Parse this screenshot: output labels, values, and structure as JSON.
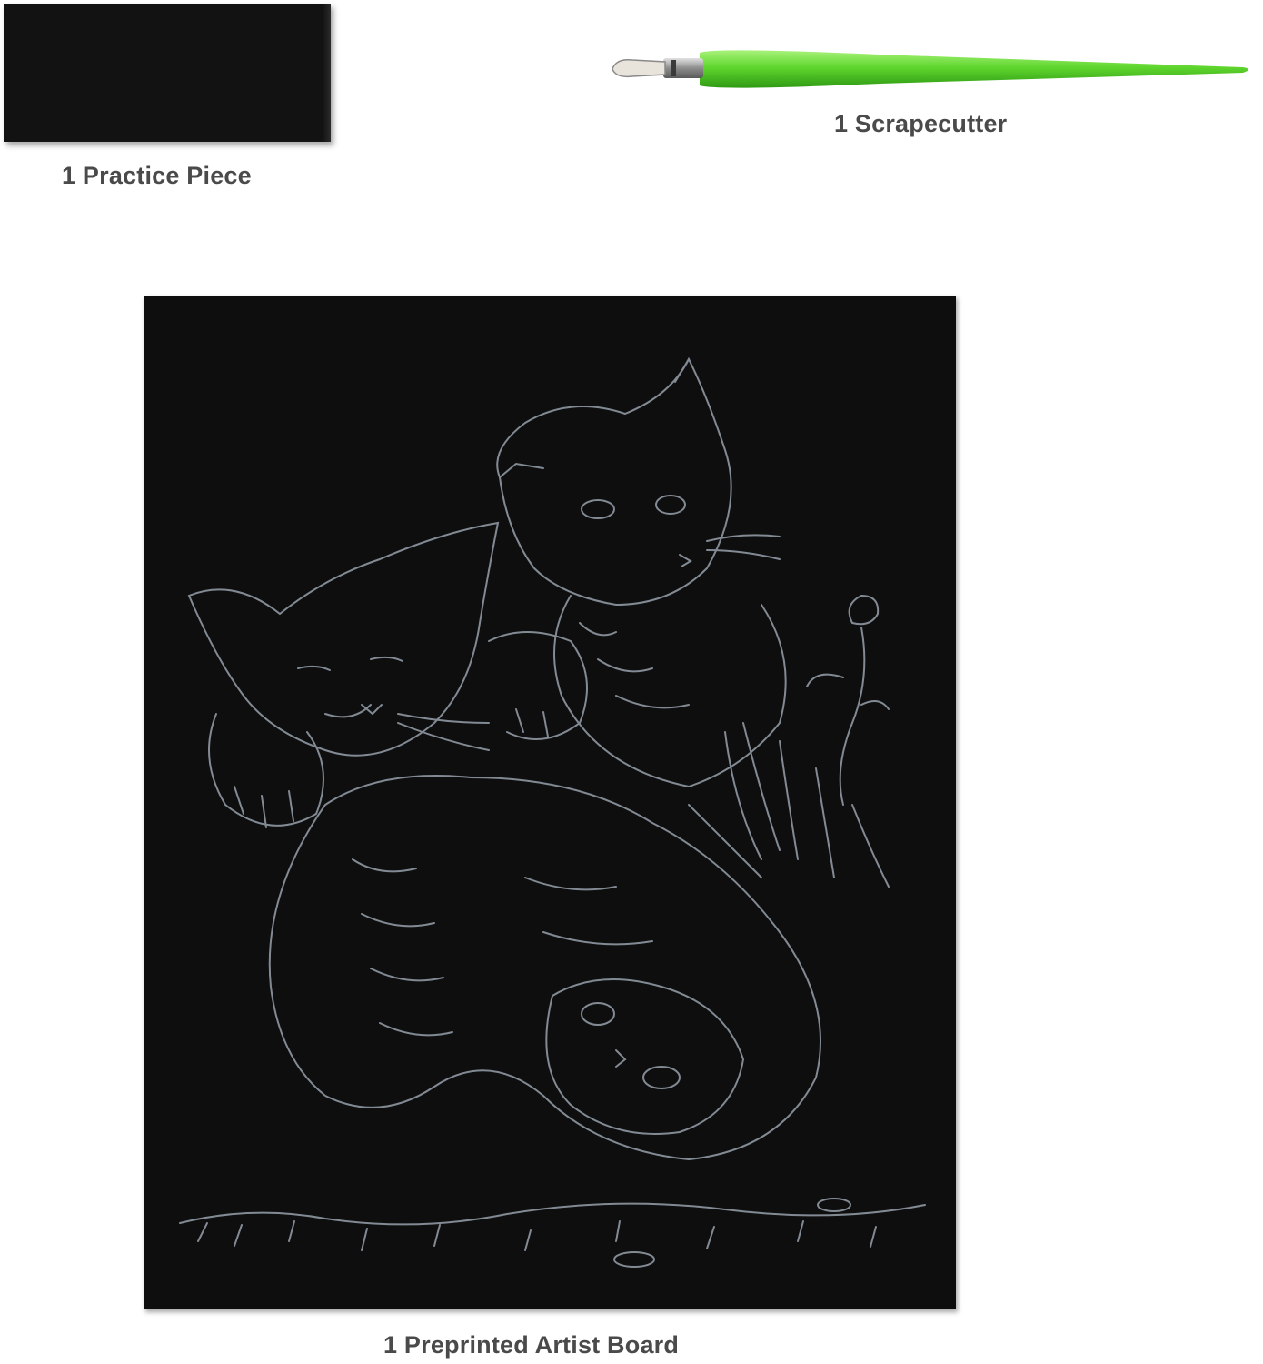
{
  "items": {
    "practice_piece": {
      "label": "1 Practice Piece",
      "color": "#121212"
    },
    "scrapecutter": {
      "label": "1 Scrapecutter",
      "handle_color": "#5fd62e",
      "tip_color": "#b8b8b8"
    },
    "artist_board": {
      "label": "1 Preprinted Artist Board",
      "background_color": "#0e0e0e",
      "engraving_color": "#8f98a3"
    }
  },
  "text_color": "#4a4a4a"
}
